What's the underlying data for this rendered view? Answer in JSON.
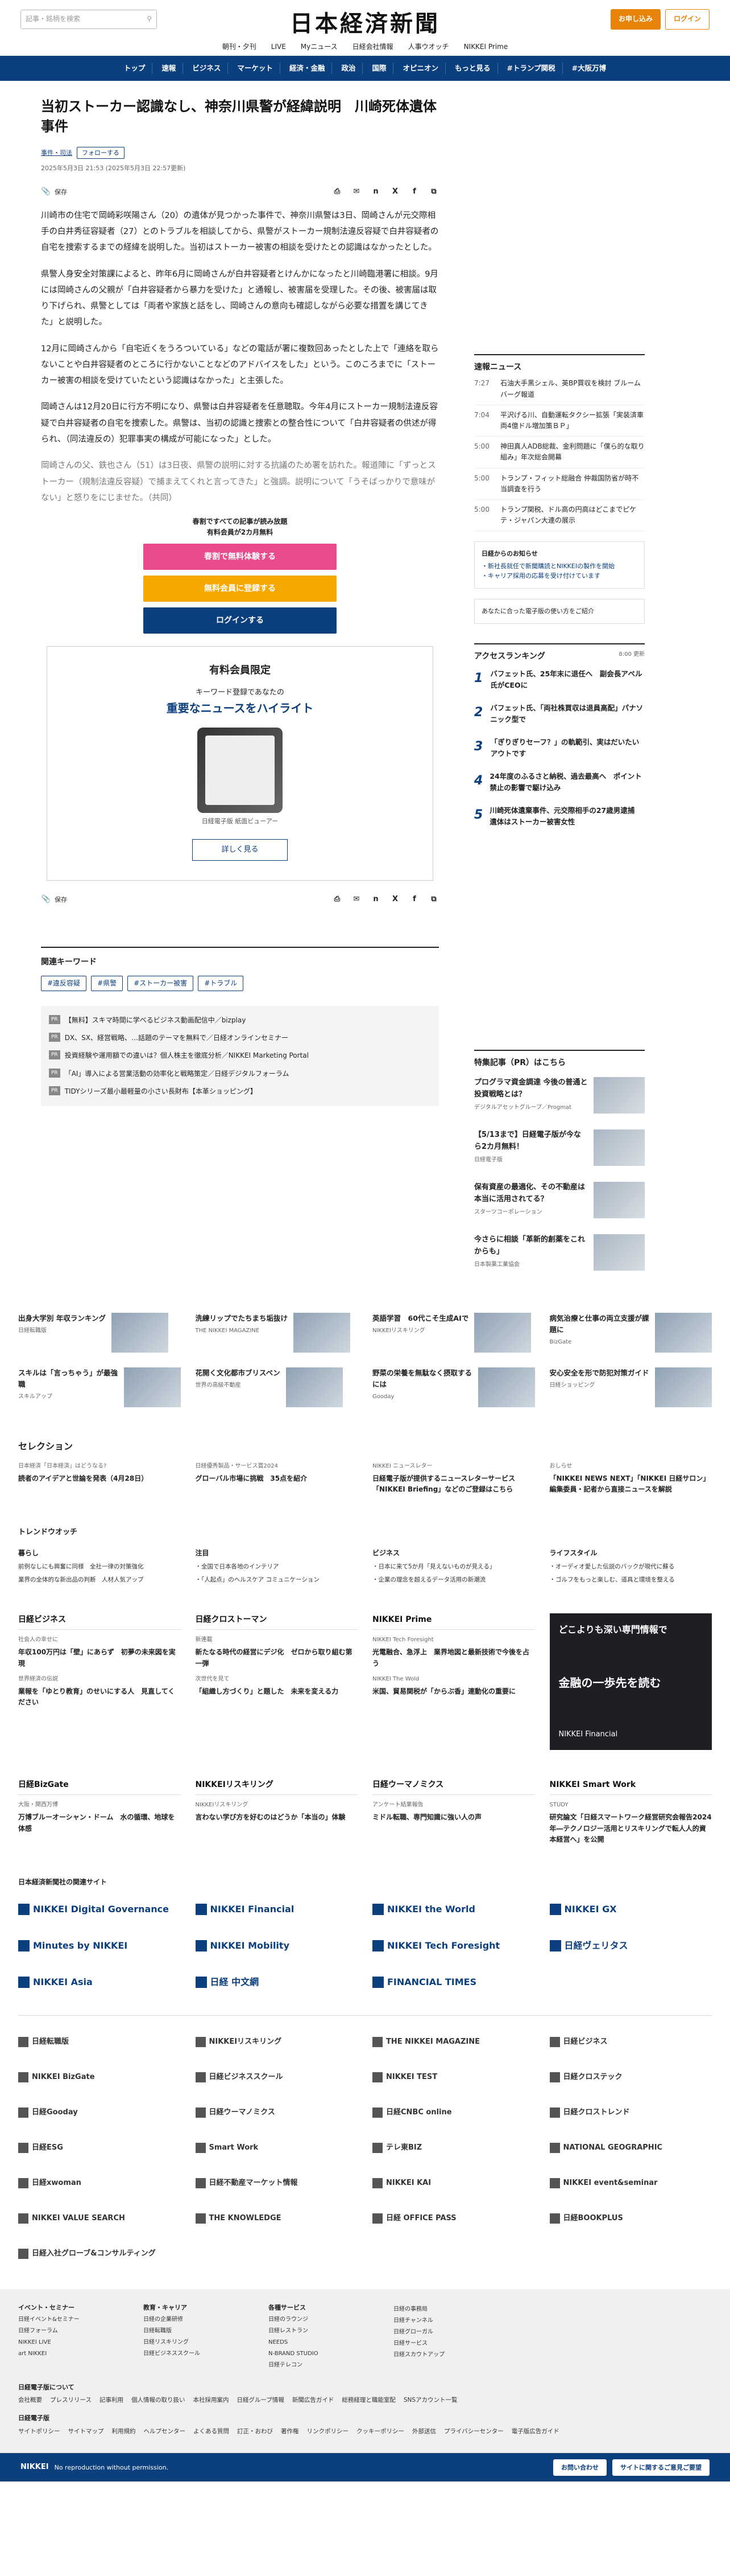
{
  "header": {
    "search_placeholder": "記事・銘柄を検索",
    "logo": "日本経済新聞",
    "btn_subscribe": "お申し込み",
    "btn_login": "ログイン",
    "sub_nav": [
      "朝刊・夕刊",
      "LIVE",
      "Myニュース",
      "日経会社情報",
      "人事ウオッチ",
      "NIKKEI Prime"
    ],
    "main_nav": [
      "トップ",
      "速報",
      "ビジネス",
      "マーケット",
      "経済・金融",
      "政治",
      "国際",
      "オピニオン",
      "もっと見る",
      "#トランプ関税",
      "#大阪万博"
    ]
  },
  "article": {
    "headline": "当初ストーカー認識なし、神奈川県警が経緯説明　川崎死体遺体事件",
    "tag": "事件・司法",
    "follow": "フォローする",
    "date": "2025年5月3日 21:53 (2025年5月3日 22:57更新)",
    "save": "保存",
    "paragraphs": [
      "川崎市の住宅で岡崎彩咲陽さん（20）の遺体が見つかった事件で、神奈川県警は3日、岡崎さんが元交際相手の白井秀征容疑者（27）とのトラブルを相談してから、県警がストーカー規制法違反容疑で白井容疑者の自宅を捜索するまでの経緯を説明した。当初はストーカー被害の相談を受けたとの認識はなかったとした。",
      "県警人身安全対策課によると、昨年6月に岡崎さんが白井容疑者とけんかになったと川崎臨港署に相談。9月には岡崎さんの父親が「白井容疑者から暴力を受けた」と通報し、被害届を受理した。その後、被害届は取り下げられ、県警としては「両者や家族と話をし、岡崎さんの意向も確認しながら必要な措置を講じてきた」と説明した。",
      "12月に岡崎さんから「自宅近くをうろついている」などの電話が署に複数回あったとした上で「連絡を取らないことや白井容疑者のところに行かないことなどのアドバイスをした」という。このころまでに「ストーカー被害の相談を受けていたという認識はなかった」と主張した。",
      "岡崎さんは12月20日に行方不明になり、県警は白井容疑者を任意聴取。今年4月にストーカー規制法違反容疑で白井容疑者の自宅を捜索した。県警は、当初の認識と捜索との整合性について「白井容疑者の供述が得られ、（同法違反の）犯罪事実の構成が可能になった」とした。",
      "岡崎さんの父、鉄也さん（51）は3日夜、県警の説明に対する抗議のため署を訪れた。報道陣に「ずっとストーカー（規制法違反容疑）で捕まえてくれと言ってきた」と強調。説明について「うそばっかりで意味がない」と怒りをにじませた。（共同）"
    ],
    "paywall_head": "春割ですべての記事が読み放題\n有料会員が2カ月無料",
    "cta_trial": "春割で無料体験する",
    "cta_register": "無料会員に登録する",
    "cta_login": "ログインする",
    "member_title": "有料会員限定",
    "member_sub": "キーワード登録であなたの",
    "member_big": "重要なニュースをハイライト",
    "member_cap": "日経電子版 紙面ビューアー",
    "member_more": "詳しく見る",
    "keywords_title": "関連キーワード",
    "keywords": [
      "#違反容疑",
      "#県警",
      "#ストーカー被害",
      "#トラブル"
    ],
    "ads": [
      "【無料】スキマ時間に学べるビジネス動画配信中／bizplay",
      "DX、SX、経営戦略、…話題のテーマを無料で／日経オンラインセミナー",
      "投資経験や運用額での違いは？個人株主を徹底分析／NIKKEI Marketing Portal",
      "「AI」導入による営業活動の効率化と戦略策定／日経デジタルフォーラム",
      "TIDYシリーズ最小最軽量の小さい長財布【本革ショッピング】"
    ]
  },
  "sidebar": {
    "latest_title": "速報ニュース",
    "latest": [
      {
        "t": "7:27",
        "h": "石油大手黒シェル、英BP買収を検討 ブルームバーグ報道"
      },
      {
        "t": "7:04",
        "h": "平沢げる川、自動運転タクシー拡張「実装済車両4億ドル増加策ＢＰ」"
      },
      {
        "t": "5:00",
        "h": "神田真人ADB総裁、金利問題に「僕ら的な取り組み」年次総会開幕"
      },
      {
        "t": "5:00",
        "h": "トランプ・フィット総融合 仲裁国防省が時不当調査を行う"
      },
      {
        "t": "5:00",
        "h": "トランプ関税、ドル高の円高はどこまでピケテ・ジャパン大連の展示"
      }
    ],
    "promo_title": "日経からのお知らせ",
    "promo_lines": [
      "・新社長就任で新聞購読とNIKKEIの製作を開始",
      "・キャリア採用の応募を受け付けています"
    ],
    "promo2": "あなたに合った電子版の使い方をご紹介",
    "ranking_title": "アクセスランキング",
    "ranking_time": "8:00 更新",
    "ranking": [
      "バフェット氏、25年末に退任へ　副会長アベル氏がCEOに",
      "バフェット氏、「両社株買収は退員高配」パナソニック型で",
      "「ぎりぎりセーフ？」の軌範引、実はだいたいアウトです",
      "24年度のふるさと納税、過去最高へ　ポイント禁止の影響で駆け込み",
      "川崎死体遺棄事件、元交際相手の27歳男逮捕　遺体はストーカー被害女性"
    ],
    "pr_title": "特集記事（PR）はこちら",
    "pr": [
      {
        "h": "プログラマ資金調達 今後の普通と投資戦略とは？",
        "s": "デジタルアセットグループ／Progmat"
      },
      {
        "h": "【5/13まで】日経電子版が今なら2カ月無料！",
        "s": "日経電子版"
      },
      {
        "h": "保有資産の最適化、その不動産は本当に活用されてる？",
        "s": "スターツコーポレーション"
      },
      {
        "h": "今さらに相談「革新的創薬をこれからも」",
        "s": "日本製薬工業協会"
      }
    ]
  },
  "lower": {
    "grid": [
      {
        "h": "出身大学別 年収ランキング",
        "s": "日経転職版"
      },
      {
        "h": "洗練リップでたちまち垢抜け",
        "s": "THE NIKKEI MAGAZINE"
      },
      {
        "h": "英語学習　60代こそ生成AIで",
        "s": "NIKKEIリスキリング"
      },
      {
        "h": "病気治療と仕事の両立支援が課題に",
        "s": "BizGate"
      },
      {
        "h": "スキルは「言っちゃう」が最強職",
        "s": "スキルアップ"
      },
      {
        "h": "花開く文化都市ブリスベン",
        "s": "世界の高級不動産"
      },
      {
        "h": "野菜の栄養を無駄なく摂取するには",
        "s": "Gooday"
      },
      {
        "h": "安心安全を形で防犯対策ガイド",
        "s": "日経ショッピング"
      }
    ],
    "selection_title": "セレクション",
    "selection": [
      {
        "lab": "日本経済「日本経済」はどうなる?",
        "h": "読者のアイデアと世論を発表（4月28日）"
      },
      {
        "lab": "日経優秀製品・サービス賞2024",
        "h": "グローバル市場に挑戦　35点を紹介"
      },
      {
        "lab": "NIKKEI ニュースレター",
        "h": "日経電子版が提供するニュースレターサービス「NIKKEI Briefing」などのご登録はこちら"
      },
      {
        "lab": "おしらせ",
        "h": "「NIKKEI NEWS NEXT」「NIKKEI 日経サロン」編集委員・記者から直接ニュースを解説"
      }
    ],
    "trend_title": "トレンドウオッチ",
    "trend": [
      {
        "c": "暮らし",
        "li": [
          "前例なしにも興奮に同様　全社一律の対策強化",
          "業界の全体的な新出品の判断　人材人気アップ"
        ]
      },
      {
        "c": "注目",
        "li": [
          "・全国で日本各地のインテリア",
          "・「人起点」のヘルスケア コミュニケーション"
        ]
      },
      {
        "c": "ビジネス",
        "li": [
          "・日本に来て5か月「見えないものが見える」",
          "・企業の理念を超えるデータ活用の新潮流"
        ]
      },
      {
        "c": "ライフスタイル",
        "li": [
          "・オーディオ愛した伝説のバックが現代に蘇る",
          "・ゴルフをもっと楽しむ、道具と環境を整える"
        ]
      }
    ],
    "blocks": [
      {
        "bt": "日経ビジネス",
        "items": [
          {
            "lab": "社会人の幸せに",
            "h": "年収100万円は「壁」にあらず　初夢の未来図を実現"
          },
          {
            "lab": "世界経済の伝説",
            "h": "業報を「ゆとり教育」のせいにする人　見直してください"
          }
        ]
      },
      {
        "bt": "日経クロストーマン",
        "items": [
          {
            "lab": "新連載",
            "h": "新たなる時代の経営にデジ化　ゼロから取り組む第一弾"
          },
          {
            "lab": "次世代を見て",
            "h": "「組織し方づくり」と題した　未来を変える力"
          }
        ]
      },
      {
        "bt": "NIKKEI Prime",
        "items": [
          {
            "lab": "NIKKEI Tech Foresight",
            "h": "光電融合、急浮上　業界地図と最新技術で今後を占う"
          },
          {
            "lab": "NIKKEI The Wold",
            "h": "米国、貿易関税が「からぶ香」連動化の重要に"
          }
        ]
      }
    ],
    "fin_a": "どこよりも深い専門情報で",
    "fin_b": "金融の一歩先を読む",
    "fin_logo": "NIKKEI Financial",
    "blocks2": [
      {
        "bt": "日経BizGate",
        "items": [
          {
            "lab": "大阪・関西万博",
            "h": "万博ブルーオーシャン・ドーム　水の循環、地球を体感"
          }
        ]
      },
      {
        "bt": "NIKKEIリスキリング",
        "items": [
          {
            "lab": "NIKKEIリスキリング",
            "h": "言わない学び方を好むのはどうか「本当の」体験"
          }
        ]
      },
      {
        "bt": "日経ウーマノミクス",
        "items": [
          {
            "lab": "アンケート結果報告",
            "h": "ミドル転職、専門知識に強い人の声"
          }
        ]
      },
      {
        "bt": "NIKKEI Smart Work",
        "items": [
          {
            "lab": "STUDY",
            "h": "研究論文「日経スマートワーク経営研究会報告2024年―テクノロジー活用とリスキリングで転人人的資本経営へ」を公開"
          }
        ]
      }
    ],
    "brands_title": "日本経済新聞社の関連サイト",
    "brands": [
      "NIKKEI Digital Governance",
      "NIKKEI Financial",
      "NIKKEI the World",
      "NIKKEI GX",
      "Minutes by NIKKEI",
      "NIKKEI Mobility",
      "NIKKEI Tech Foresight",
      "日経ヴェリタス",
      "NIKKEI Asia",
      "日経 中文網",
      "FINANCIAL TIMES"
    ],
    "brands2": [
      "日経転職版",
      "NIKKEIリスキリング",
      "THE NIKKEI MAGAZINE",
      "日経ビジネス",
      "NIKKEI BizGate",
      "日経ビジネススクール",
      "NIKKEI TEST",
      "日経クロステック",
      "日経Gooday",
      "日経ウーマノミクス",
      "日経CNBC online",
      "日経クロストレンド",
      "日経ESG",
      "Smart Work",
      "テレ東BIZ",
      "NATIONAL GEOGRAPHIC",
      "日経xwoman",
      "日経不動産マーケット情報",
      "NIKKEI KAI",
      "NIKKEI event&seminar",
      "NIKKEI VALUE SEARCH",
      "THE KNOWLEDGE",
      "日経 OFFICE PASS",
      "日経BOOKPLUS",
      "日経入社グローブ&コンサルティング"
    ]
  },
  "footer": {
    "cols": [
      {
        "ft": "イベント・セミナー",
        "li": [
          "日経イベント&セミナー",
          "日経フォーラム",
          "NIKKEI LIVE",
          "art NIKKEI"
        ]
      },
      {
        "ft": "教育・キャリア",
        "li": [
          "日経の企業研修",
          "日経転職版",
          "日経リスキリング",
          "日経ビジネススクール"
        ]
      },
      {
        "ft": "各種サービス",
        "li": [
          "日経のラウンジ",
          "日経レストラン",
          "NEEDS",
          "N-BRAND STUDIO",
          "日経テレコン"
        ]
      },
      {
        "ft": "",
        "li": [
          "日経の事務局",
          "日経チャンネル",
          "日経グローガル",
          "日経サービス",
          "日経スカウトアップ"
        ]
      }
    ],
    "links1_title": "日経電子版について",
    "links1": [
      "会社概要",
      "プレスリリース",
      "記事利用",
      "個人情報の取り扱い",
      "本社採用案内",
      "日経グループ情報",
      "新聞広告ガイド",
      "総務経理と職能室配",
      "SNSアカウント一覧"
    ],
    "links2_title": "日経電子版",
    "links2": [
      "サイトポリシー",
      "サイトマップ",
      "利用規約",
      "ヘルプセンター",
      "よくある質問",
      "訂正・おわび",
      "著作権",
      "リンクポリシー",
      "クッキーポリシー",
      "外部送信",
      "プライバシーセンター",
      "電子版広告ガイド"
    ],
    "bottom_logo": "NIKKEI",
    "bottom_note": "No reproduction without permission.",
    "btn_contact": "お問い合わせ",
    "btn_feedback": "サイトに関するご意見ご要望"
  }
}
